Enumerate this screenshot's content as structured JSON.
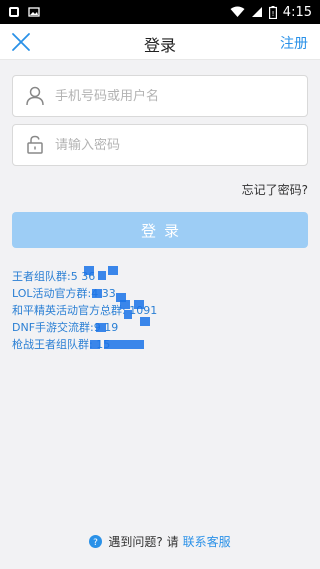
{
  "status_bar": {
    "time": "4:15",
    "icons": [
      "notification-icon",
      "image-icon",
      "wifi-icon",
      "signal-icon",
      "battery-icon"
    ]
  },
  "header": {
    "title": "登录",
    "register_label": "注册",
    "close_icon": "close-icon"
  },
  "form": {
    "username_placeholder": "手机号码或用户名",
    "password_placeholder": "请输入密码",
    "username_icon": "user-icon",
    "password_icon": "lock-icon"
  },
  "forgot_label": "忘记了密码?",
  "login_label": "登录",
  "groups": [
    "王者组队群:5       36",
    "LOL活动官方群:4      33",
    "和平精英活动官方总群:      1091",
    "DNF手游交流群:9      19",
    "枪战王者组队群:      15"
  ],
  "footer": {
    "help_text": "遇到问题? 请",
    "service_label": "联系客服",
    "help_icon": "question-icon"
  },
  "colors": {
    "accent": "#2a91e8",
    "button_disabled": "#9dcdf5",
    "background": "#f2f2f4"
  }
}
